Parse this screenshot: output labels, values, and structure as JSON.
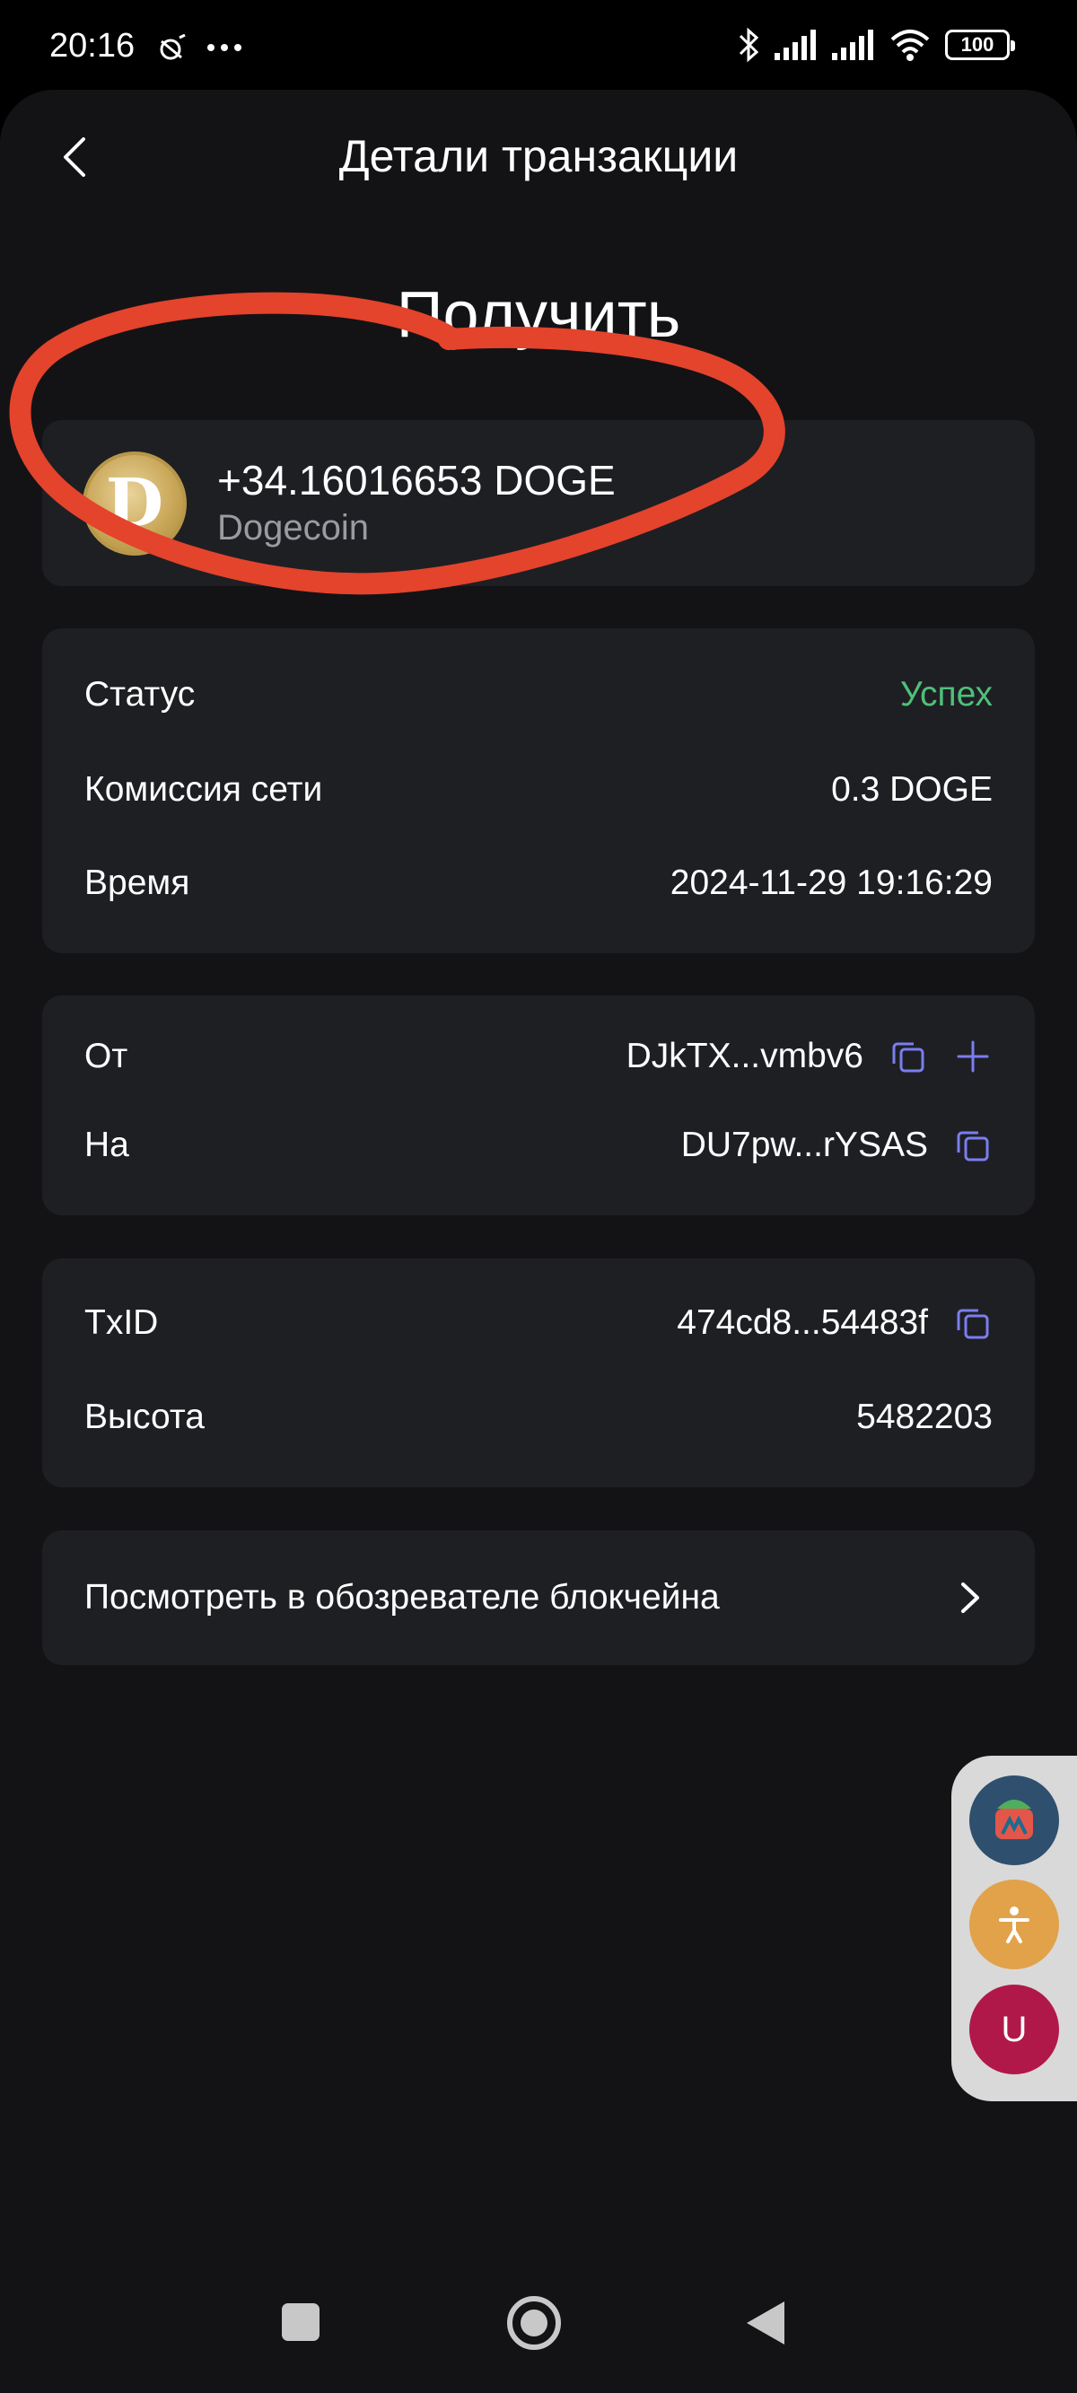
{
  "status_bar": {
    "time": "20:16",
    "battery": "100"
  },
  "header": {
    "title": "Детали транзакции"
  },
  "page_heading": "Получить",
  "transaction": {
    "amount": "+34.16016653 DOGE",
    "coin_name": "Dogecoin",
    "coin_letter": "D"
  },
  "details": {
    "status_label": "Статус",
    "status_value": "Успех",
    "fee_label": "Комиссия сети",
    "fee_value": "0.3 DOGE",
    "time_label": "Время",
    "time_value": "2024-11-29 19:16:29"
  },
  "addresses": {
    "from_label": "От",
    "from_value": "DJkTX...vmbv6",
    "to_label": "На",
    "to_value": "DU7pw...rYSAS"
  },
  "chain": {
    "txid_label": "TxID",
    "txid_value": "474cd8...54483f",
    "height_label": "Высота",
    "height_value": "5482203"
  },
  "explorer": {
    "label": "Посмотреть в обозревателе блокчейна"
  },
  "floating": {
    "third_label": "U"
  },
  "colors": {
    "background": "#131316",
    "card": "#1e1f23",
    "success": "#4fbf7a",
    "accent_icon": "#7b7df0",
    "annotation": "#e4432c"
  }
}
